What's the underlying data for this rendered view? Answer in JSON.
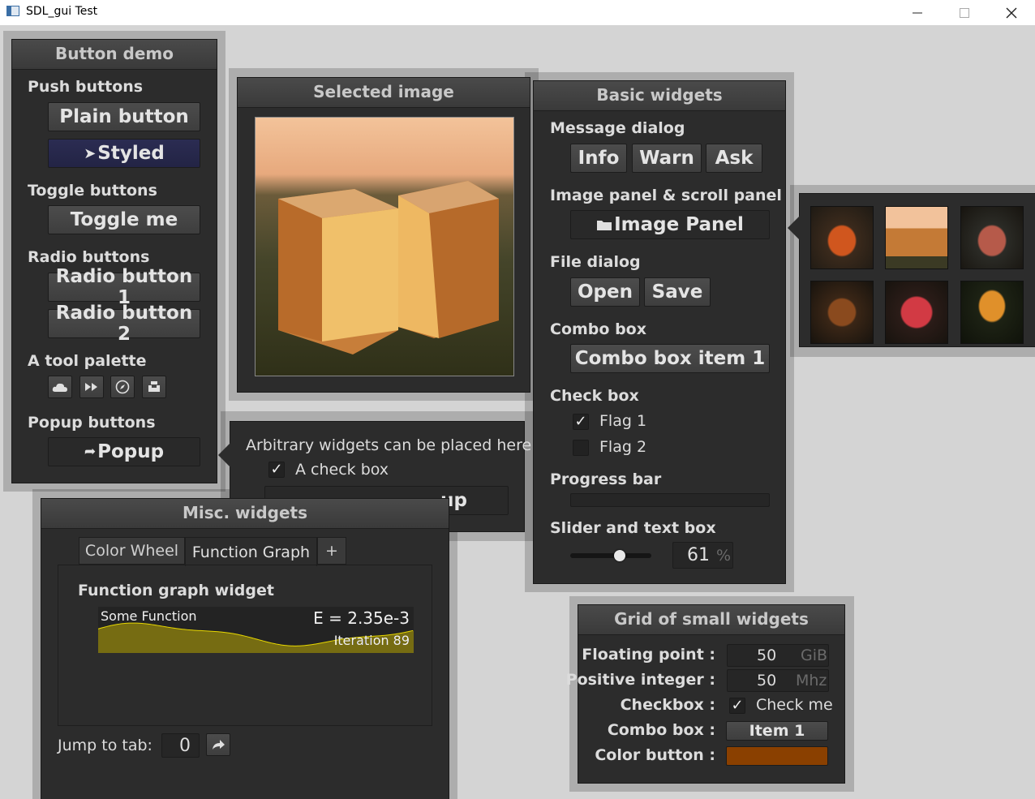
{
  "window": {
    "title": "SDL_gui Test"
  },
  "button_demo": {
    "title": "Button demo",
    "push_label": "Push buttons",
    "plain_button": "Plain button",
    "styled_button": "Styled",
    "toggle_label": "Toggle buttons",
    "toggle_button": "Toggle me",
    "radio_label": "Radio buttons",
    "radio1": "Radio button 1",
    "radio2": "Radio button 2",
    "palette_label": "A tool palette",
    "popup_label": "Popup buttons",
    "popup_button": "Popup"
  },
  "popup_panel": {
    "text": "Arbitrary widgets can be placed here",
    "checkbox_label": "A check box",
    "checkbox_checked": true,
    "button_visible_text": "up"
  },
  "selected_image": {
    "title": "Selected image"
  },
  "basic_widgets": {
    "title": "Basic widgets",
    "message_label": "Message dialog",
    "info": "Info",
    "warn": "Warn",
    "ask": "Ask",
    "image_panel_label": "Image panel & scroll panel",
    "image_panel_button": "Image Panel",
    "file_dialog_label": "File dialog",
    "open": "Open",
    "save": "Save",
    "combo_label": "Combo box",
    "combo_value": "Combo box item 1",
    "checkbox_label": "Check box",
    "flag1": "Flag 1",
    "flag1_checked": true,
    "flag2": "Flag 2",
    "flag2_checked": false,
    "progress_label": "Progress bar",
    "progress_value": 0,
    "slider_label": "Slider and text box",
    "slider_fraction": 0.61,
    "slider_value": "61",
    "slider_unit": "%"
  },
  "misc_widgets": {
    "title": "Misc. widgets",
    "tabs": [
      "Color Wheel",
      "Function Graph",
      "+"
    ],
    "active_tab": "Function Graph",
    "graph_label": "Function graph widget",
    "graph_caption": "Some Function",
    "graph_header": "E = 2.35e-3",
    "graph_footer": "Iteration 89",
    "jump_label": "Jump to tab:",
    "jump_value": "0"
  },
  "grid_widgets": {
    "title": "Grid of small widgets",
    "rows": [
      {
        "label": "Floating point :",
        "value": "50",
        "unit": "GiB"
      },
      {
        "label": "Positive integer :",
        "value": "50",
        "unit": "Mhz"
      },
      {
        "label": "Checkbox :",
        "value": "Check me",
        "checked": true
      },
      {
        "label": "Combo box :",
        "value": "Item 1"
      },
      {
        "label": "Color button :",
        "color": "#8a4000"
      }
    ]
  },
  "colors": {
    "window_bg": "#2c2c2c",
    "desktop": "#d4d4d4",
    "styled_button": "#2b2c52",
    "graph_line": "#c8b400",
    "color_button": "#8a4000"
  }
}
